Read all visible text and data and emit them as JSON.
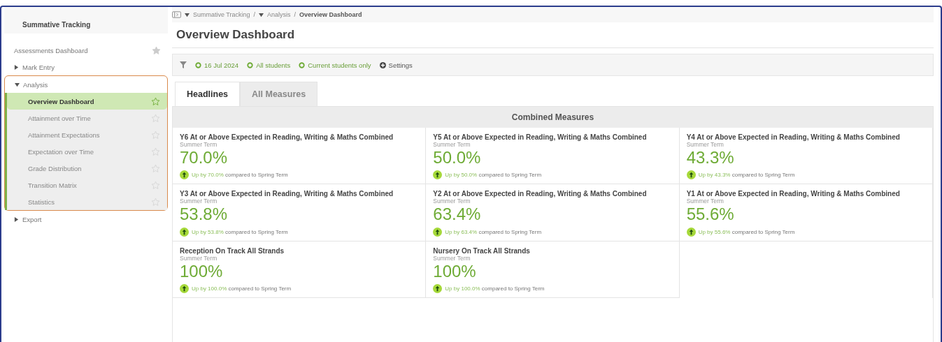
{
  "sidebar": {
    "title": "Summative Tracking",
    "items": [
      {
        "label": "Assessments Dashboard",
        "selected": false
      },
      {
        "label": "Mark Entry",
        "expanded": false,
        "selected": false
      },
      {
        "label": "Analysis",
        "expanded": true,
        "selected": false,
        "children": [
          {
            "label": "Overview Dashboard",
            "selected": true
          },
          {
            "label": "Attainment over Time",
            "selected": false
          },
          {
            "label": "Attainment Expectations",
            "selected": false
          },
          {
            "label": "Expectation over Time",
            "selected": false
          },
          {
            "label": "Grade Distribution",
            "selected": false
          },
          {
            "label": "Transition Matrix",
            "selected": false
          },
          {
            "label": "Statistics",
            "selected": false
          }
        ]
      },
      {
        "label": "Export",
        "expanded": false,
        "selected": false
      }
    ]
  },
  "breadcrumb_separator": "/",
  "breadcrumb": [
    {
      "label": "Summative Tracking",
      "kind": "menu"
    },
    {
      "label": "Analysis",
      "kind": "menu"
    },
    {
      "label": "Overview Dashboard",
      "kind": "current"
    }
  ],
  "page_title": "Overview Dashboard",
  "filters": [
    {
      "label": "16 Jul 2024",
      "kind": "active"
    },
    {
      "label": "All students",
      "kind": "active"
    },
    {
      "label": "Current students only",
      "kind": "active"
    },
    {
      "label": "Settings",
      "kind": "settings"
    }
  ],
  "tabs": [
    {
      "label": "Headlines",
      "selected": true
    },
    {
      "label": "All Measures",
      "selected": false
    }
  ],
  "section_title": "Combined Measures",
  "measures": [
    {
      "title": "Y6 At or Above Expected in Reading, Writing & Maths Combined",
      "term": "Summer Term",
      "value": "70.0%",
      "change": "Up by 70.0%",
      "comparison": "compared to Spring Term"
    },
    {
      "title": "Y5 At or Above Expected in Reading, Writing & Maths Combined",
      "term": "Summer Term",
      "value": "50.0%",
      "change": "Up by 50.0%",
      "comparison": "compared to Spring Term"
    },
    {
      "title": "Y4 At or Above Expected in Reading, Writing & Maths Combined",
      "term": "Summer Term",
      "value": "43.3%",
      "change": "Up by 43.3%",
      "comparison": "compared to Spring Term"
    },
    {
      "title": "Y3 At or Above Expected in Reading, Writing & Maths Combined",
      "term": "Summer Term",
      "value": "53.8%",
      "change": "Up by 53.8%",
      "comparison": "compared to Spring Term"
    },
    {
      "title": "Y2 At or Above Expected in Reading, Writing & Maths Combined",
      "term": "Summer Term",
      "value": "63.4%",
      "change": "Up by 63.4%",
      "comparison": "compared to Spring Term"
    },
    {
      "title": "Y1 At or Above Expected in Reading, Writing & Maths Combined",
      "term": "Summer Term",
      "value": "55.6%",
      "change": "Up by 55.6%",
      "comparison": "compared to Spring Term"
    },
    {
      "title": "Reception On Track All Strands",
      "term": "Summer Term",
      "value": "100%",
      "change": "Up by 100.0%",
      "comparison": "compared to Spring Term"
    },
    {
      "title": "Nursery On Track All Strands",
      "term": "Summer Term",
      "value": "100%",
      "change": "Up by 100.0%",
      "comparison": "compared to Spring Term"
    }
  ]
}
